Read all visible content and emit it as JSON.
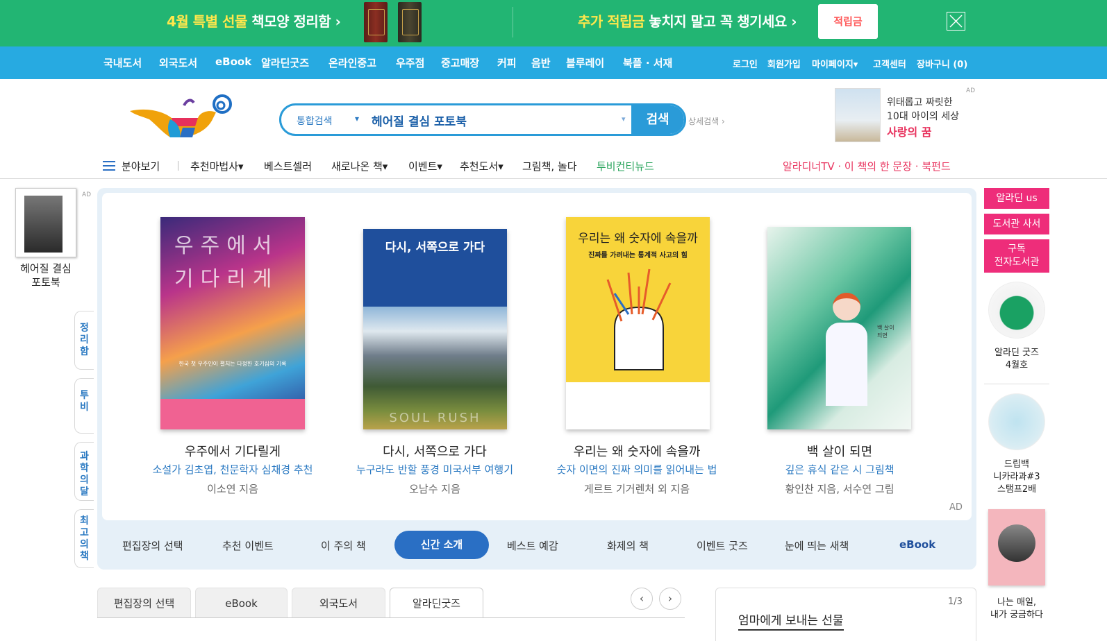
{
  "promo": {
    "left_highlight": "4월 특별 선물",
    "left_text": " 책모양 정리함 ›",
    "right_highlight": "추가 적립금",
    "right_text": " 놓치지 말고 꼭 챙기세요 ›",
    "coin_label": "적립금"
  },
  "gnb": {
    "items": [
      "국내도서",
      "외국도서",
      "eBook",
      "알라딘굿즈",
      "온라인중고",
      "우주점",
      "중고매장",
      "커피",
      "음반",
      "블루레이",
      "북플 · 서재"
    ],
    "util": [
      "로그인",
      "회원가입",
      "마이페이지▾",
      "고객센터",
      "장바구니 (0)"
    ]
  },
  "search": {
    "category": "통합검색",
    "value": "헤어질 결심 포토북",
    "button": "검색",
    "advanced": "상세검색 ›"
  },
  "header_ad": {
    "line1": "위태롭고 짜릿한",
    "line2": "10대 아이의 세상",
    "line3": "사랑의 꿈",
    "tag": "AD"
  },
  "category_nav": {
    "menu": "분야보기",
    "items": [
      "추천마법사▾",
      "베스트셀러",
      "새로나온 책▾",
      "이벤트▾",
      "추천도서▾",
      "그림책, 놀다"
    ],
    "green": "투비컨티뉴드",
    "right": "알라디너TV · 이 책의 한 문장 · 북펀드"
  },
  "left_ad": {
    "tag": "AD",
    "title": "헤어질 결심\n포토북"
  },
  "vertical_tabs": [
    "정리함",
    "투비",
    "과학의달",
    "최고의책"
  ],
  "books": [
    {
      "title": "우주에서 기다릴게",
      "subtitle": "소설가 김초엽, 천문학자 심채경 추천",
      "author": "이소연 지음",
      "cover_title": "우주에서 기다리게",
      "cover_caption": "한국 첫 우주인이 펼치는 다정한 호기심의 기록"
    },
    {
      "title": "다시, 서쪽으로 가다",
      "subtitle": "누구라도 반할 풍경 미국서부 여행기",
      "author": "오남수 지음",
      "cover_title": "다시, 서쪽으로 가다",
      "cover_caption": "SOUL RUSH"
    },
    {
      "title": "우리는 왜 숫자에 속을까",
      "subtitle": "숫자 이면의 진짜 의미를 읽어내는 법",
      "author": "게르트 기거렌처 외 지음",
      "cover_title": "우리는 왜 숫자에 속을까",
      "cover_caption": "진짜를 가려내는 통계적 사고의 힘"
    },
    {
      "title": "백 살이 되면",
      "subtitle": "깊은 휴식 같은 시 그림책",
      "author": "황인찬 지음, 서수연 그림",
      "cover_title": "백 살이 되면",
      "cover_caption": ""
    }
  ],
  "main_ad_tag": "AD",
  "tabbar": {
    "items": [
      "편집장의 선택",
      "추천 이벤트",
      "이 주의 책",
      "신간 소개",
      "베스트 예감",
      "화제의 책",
      "이벤트 굿즈",
      "눈에 띄는 새책",
      "eBook"
    ],
    "active": "신간 소개"
  },
  "bottom_tabs": {
    "items": [
      "편집장의 선택",
      "eBook",
      "외국도서",
      "알라딘굿즈"
    ],
    "active": "알라딘굿즈"
  },
  "right_box": {
    "page": "1/3",
    "title": "엄마에게 보내는 선물"
  },
  "right_side": {
    "buttons": [
      "알라딘 us",
      "도서관 사서",
      "구독\n전자도서관"
    ],
    "items": [
      {
        "label": "알라딘 굿즈\n4월호"
      },
      {
        "label": "드립백\n니카라과#3\n스탬프2배"
      },
      {
        "label": "나는 매일,\n내가 궁금하다"
      }
    ]
  },
  "colors": {
    "promo_bg": "#22b573",
    "nav_bg": "#27aae1",
    "accent_blue": "#2a6fc4",
    "pink": "#ee2d7a"
  }
}
